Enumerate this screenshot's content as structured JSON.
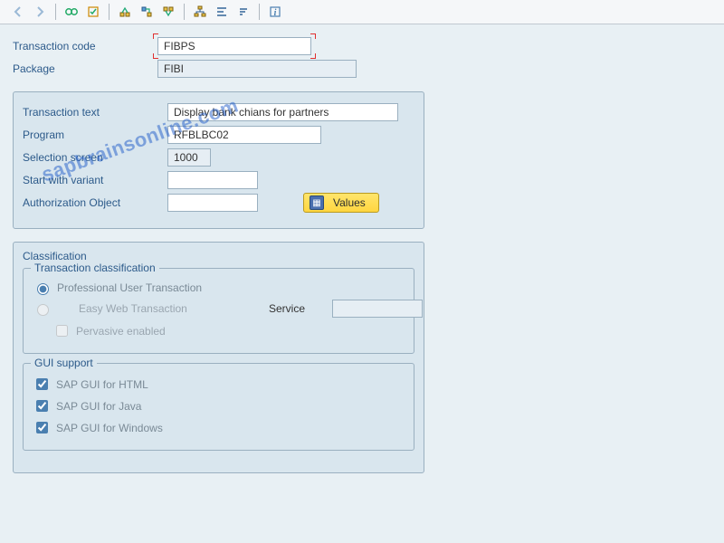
{
  "toolbar": {
    "icons": [
      "back",
      "forward",
      "exec-glasses",
      "exec-mark",
      "export",
      "import-tree",
      "where-used",
      "export2",
      "hierarchy",
      "align",
      "descending",
      "info"
    ]
  },
  "header": {
    "tcode_label": "Transaction code",
    "tcode_value": "FIBPS",
    "package_label": "Package",
    "package_value": "FIBI"
  },
  "details": {
    "text_label": "Transaction text",
    "text_value": "Display bank chians for partners",
    "program_label": "Program",
    "program_value": "RFBLBC02",
    "selscreen_label": "Selection screen",
    "selscreen_value": "1000",
    "variant_label": "Start with variant",
    "variant_value": "",
    "auth_label": "Authorization Object",
    "auth_value": "",
    "values_btn": "Values"
  },
  "classification": {
    "title": "Classification",
    "tc_title": "Transaction classification",
    "radio_professional": "Professional User Transaction",
    "radio_easyweb": "Easy Web Transaction",
    "service_label": "Service",
    "service_value": "",
    "pervasive": "Pervasive enabled",
    "gui_title": "GUI support",
    "gui_html": "SAP GUI for HTML",
    "gui_java": "SAP GUI for Java",
    "gui_win": "SAP GUI for Windows"
  },
  "watermark": "sapbrainsonline.com"
}
